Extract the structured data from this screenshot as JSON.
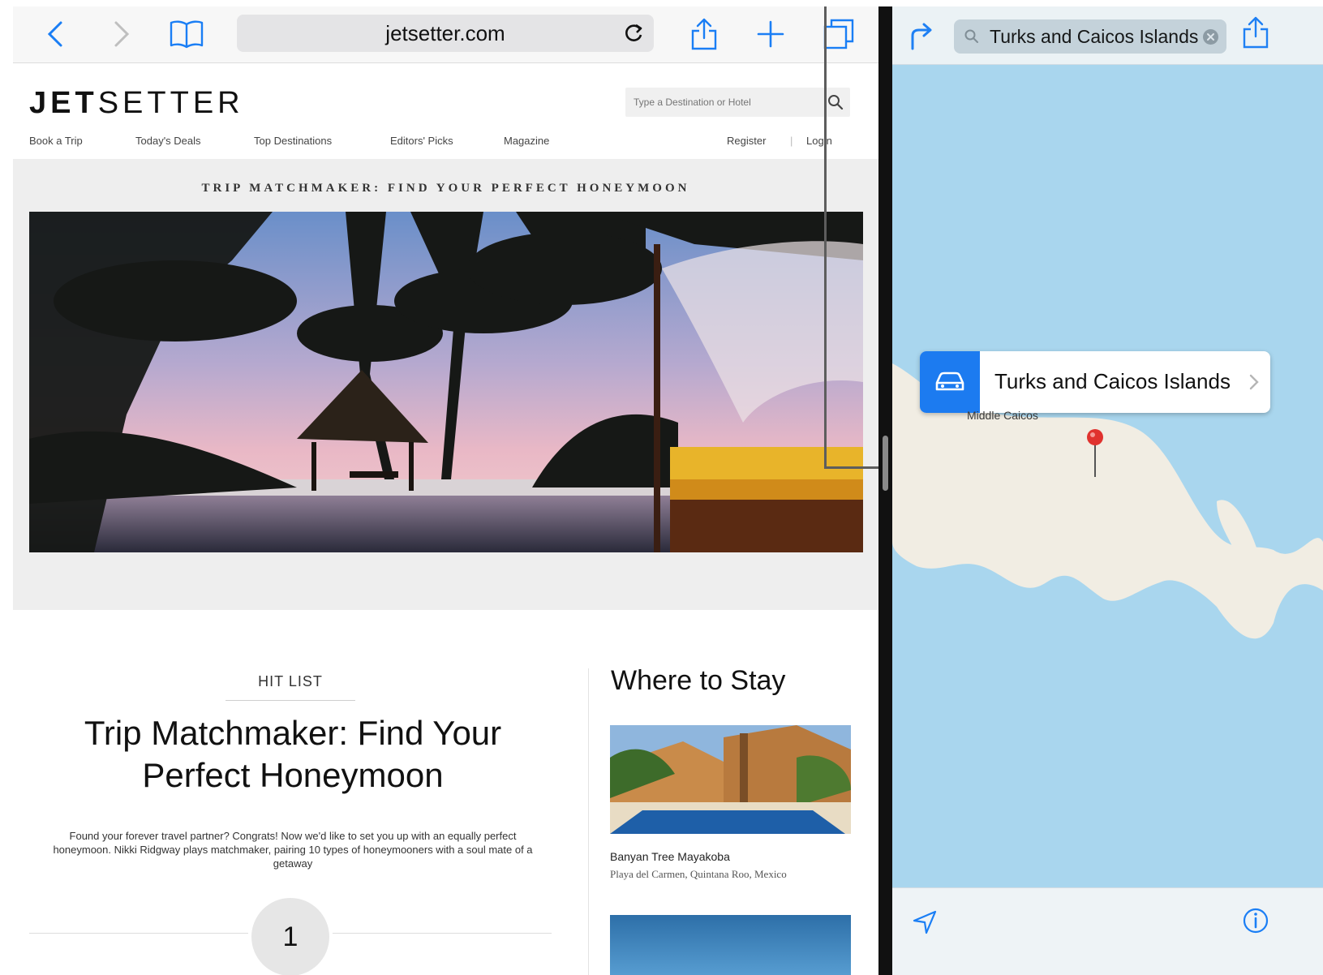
{
  "safari": {
    "url": "jetsetter.com",
    "icons": [
      "back-icon",
      "forward-icon",
      "bookmarks-icon",
      "reload-icon",
      "share-icon",
      "new-tab-icon",
      "tabs-icon"
    ]
  },
  "site": {
    "logo_bold": "JET",
    "logo_light": "SETTER",
    "search_placeholder": "Type a Destination or Hotel",
    "nav": {
      "book": "Book a Trip",
      "deals": "Today's Deals",
      "destinations": "Top Destinations",
      "picks": "Editors' Picks",
      "magazine": "Magazine",
      "register": "Register",
      "login": "Login"
    },
    "banner_title": "TRIP MATCHMAKER: FIND YOUR PERFECT HONEYMOON",
    "article": {
      "kicker": "HIT LIST",
      "headline": "Trip Matchmaker: Find Your Perfect Honeymoon",
      "excerpt": "Found your forever travel partner? Congrats! Now we'd like to set you up with an equally perfect honeymoon. Nikki Ridgway plays matchmaker, pairing 10 types of honeymooners with a soul mate of a getaway",
      "number": "1"
    },
    "sidebar": {
      "title": "Where to Stay",
      "hotel_name": "Banyan Tree Mayakoba",
      "hotel_location": "Playa del Carmen, Quintana Roo, Mexico"
    }
  },
  "maps": {
    "search_query": "Turks and Caicos Islands",
    "callout_label": "Turks and Caicos Islands",
    "place_label": "Middle Caicos",
    "icons": [
      "directions-icon",
      "search-icon",
      "clear-icon",
      "share-icon",
      "car-icon",
      "location-arrow-icon",
      "info-icon"
    ],
    "colors": {
      "water": "#a9d6ee",
      "land": "#f1ede3",
      "accent": "#1c7bf0",
      "pin": "#e0322e"
    }
  }
}
